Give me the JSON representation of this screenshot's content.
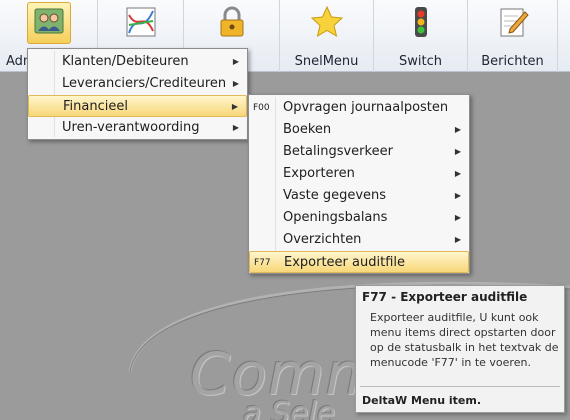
{
  "ribbon": {
    "admin_label": "Adm",
    "snelmenu_label": "SnelMenu",
    "switch_label": "Switch",
    "berichten_label": "Berichten"
  },
  "main_menu": [
    {
      "label": "Klanten/Debiteuren"
    },
    {
      "label": "Leveranciers/Crediteuren"
    },
    {
      "label": "Financieel"
    },
    {
      "label": "Uren-verantwoording"
    }
  ],
  "financieel_menu": [
    {
      "code": "F00",
      "label": "Opvragen journaalposten"
    },
    {
      "code": "",
      "label": "Boeken"
    },
    {
      "code": "",
      "label": "Betalingsverkeer"
    },
    {
      "code": "",
      "label": "Exporteren"
    },
    {
      "code": "",
      "label": "Vaste gegevens"
    },
    {
      "code": "",
      "label": "Openingsbalans"
    },
    {
      "code": "",
      "label": "Overzichten"
    },
    {
      "code": "F77",
      "label": "Exporteer auditfile"
    }
  ],
  "tooltip": {
    "title": "F77 - Exporteer auditfile",
    "body": "Exporteer auditfile, U kunt ook menu items direct opstarten door op de statusbalk in het textvak de menucode 'F77' in te voeren.",
    "footer": "DeltaW Menu item."
  },
  "background_logo": {
    "text": "Comm",
    "subtext": "a Sele"
  }
}
